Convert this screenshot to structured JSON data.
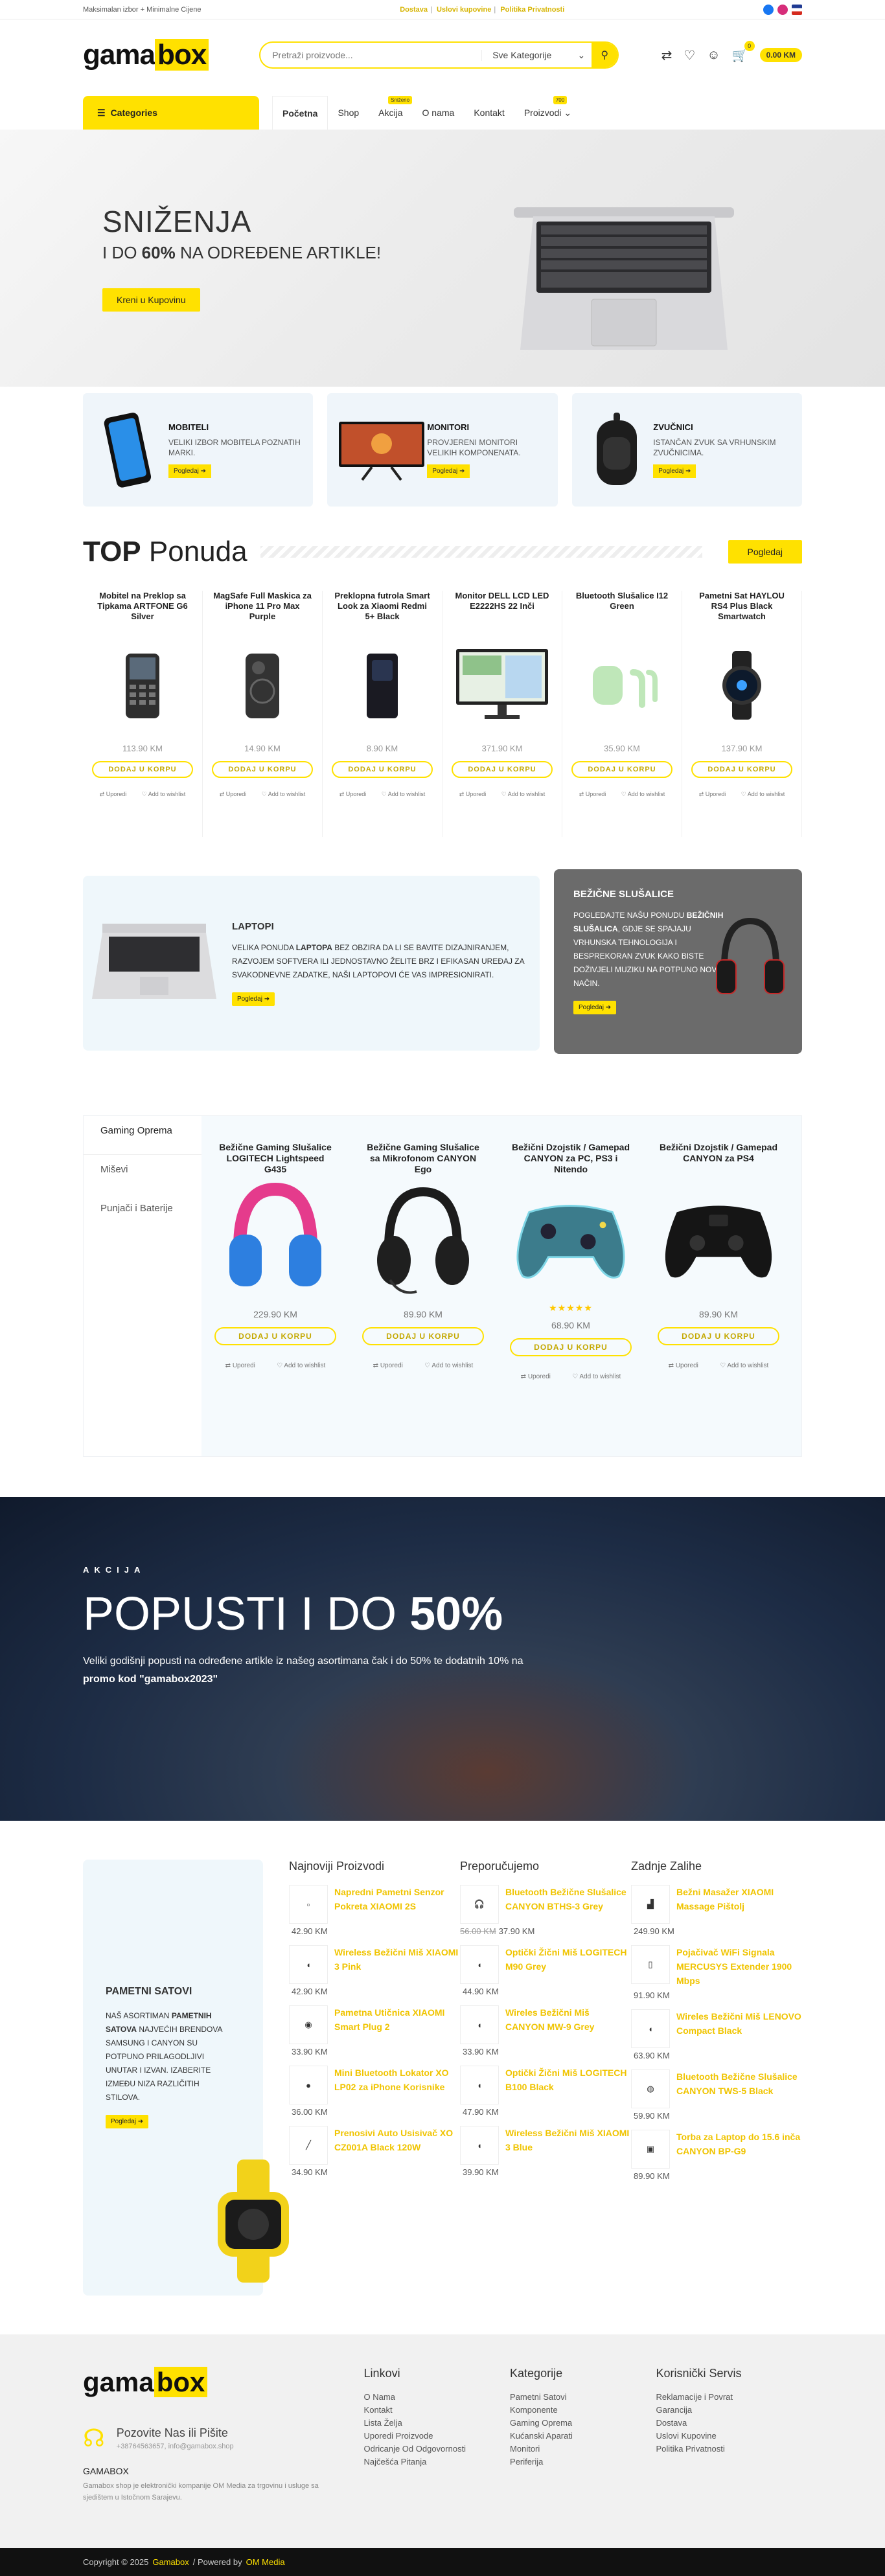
{
  "topbar": {
    "left": "Maksimalan izbor + Minimalne Cijene",
    "links": [
      "Dostava",
      "Uslovi kupovine",
      "Politika Privatnosti"
    ]
  },
  "header": {
    "logo_main": "gama",
    "logo_box": "box",
    "search_placeholder": "Pretraži proizvode...",
    "search_category": "Sve Kategorije",
    "cart_count": "0",
    "cart_total": "0.00 KM"
  },
  "nav": {
    "categories": "Categories",
    "items": [
      {
        "label": "Početna",
        "tag": ""
      },
      {
        "label": "Shop",
        "tag": ""
      },
      {
        "label": "Akcija",
        "tag": "Sniženo"
      },
      {
        "label": "O nama",
        "tag": ""
      },
      {
        "label": "Kontakt",
        "tag": ""
      },
      {
        "label": "Proizvodi",
        "tag": "700"
      }
    ]
  },
  "hero": {
    "title": "SNIŽENJA",
    "sub_pre": "I DO ",
    "sub_bold": "60%",
    "sub_post": " NA ODREĐENE ARTIKLE!",
    "button": "Kreni u Kupovinu"
  },
  "promos": [
    {
      "title": "MOBITELI",
      "text": "VELIKI IZBOR MOBITELA POZNATIH MARKI.",
      "button": "Pogledaj"
    },
    {
      "title": "MONITORI",
      "text": "PROVJERENI MONITORI VELIKIH KOMPONENATA.",
      "button": "Pogledaj"
    },
    {
      "title": "ZVUČNICI",
      "text": "ISTANČAN ZVUK SA VRHUNSKIM ZVUČNICIMA.",
      "button": "Pogledaj"
    }
  ],
  "top": {
    "title_bold": "TOP",
    "title_rest": " Ponuda",
    "button": "Pogledaj",
    "products": [
      {
        "name": "Mobitel na Preklop sa Tipkama ARTFONE G6 Silver",
        "price": "113.90 KM"
      },
      {
        "name": "MagSafe Full Maskica za iPhone 11 Pro Max Purple",
        "price": "14.90 KM"
      },
      {
        "name": "Preklopna futrola Smart Look za Xiaomi Redmi 5+ Black",
        "price": "8.90 KM"
      },
      {
        "name": "Monitor DELL LCD LED E2222HS 22 Inči",
        "price": "371.90 KM"
      },
      {
        "name": "Bluetooth Slušalice I12 Green",
        "price": "35.90 KM"
      },
      {
        "name": "Pametni Sat HAYLOU RS4 Plus Black Smartwatch",
        "price": "137.90 KM"
      }
    ],
    "add_label": "DODAJ U KORPU",
    "compare": "Uporedi",
    "wishlist": "Add to wishlist"
  },
  "laptops": {
    "title": "LAPTOPI",
    "text_pre": "VELIKA PONUDA ",
    "text_bold": "LAPTOPA",
    "text_post": " BEZ OBZIRA DA LI SE BAVITE DIZAJNIRANJEM, RAZVOJEM SOFTVERA ILI JEDNOSTAVNO ŽELITE BRZ I EFIKASAN UREĐAJ ZA SVAKODNEVNE ZADATKE, NAŠI LAPTOPOVI ĆE VAS IMPRESIONIRATI.",
    "button": "Pogledaj"
  },
  "wireless": {
    "title": "BEŽIČNE SLUŠALICE",
    "text_pre": "POGLEDAJTE NAŠU PONUDU ",
    "text_bold": "BEŽIČNIH SLUŠALICA",
    "text_post": ", GDJE SE SPAJAJU VRHUNSKA TEHNOLOGIJA I BESPREKORAN ZVUK KAKO BISTE DOŽIVJELI MUZIKU NA POTPUNO NOV NAČIN.",
    "button": "Pogledaj"
  },
  "gaming": {
    "tabs": [
      "Gaming Oprema",
      "Miševi",
      "Punjači i Baterije"
    ],
    "products": [
      {
        "name": "Bežične Gaming Slušalice LOGITECH Lightspeed G435",
        "price": "229.90 KM",
        "stars": ""
      },
      {
        "name": "Bežične Gaming Slušalice sa Mikrofonom CANYON Ego",
        "price": "89.90 KM",
        "stars": ""
      },
      {
        "name": "Bežični Dzojstik / Gamepad CANYON za PC, PS3 i Nitendo",
        "price": "68.90 KM",
        "stars": "★★★★★"
      },
      {
        "name": "Bežični Dzojstik / Gamepad CANYON za PS4",
        "price": "89.90 KM",
        "stars": ""
      }
    ]
  },
  "akcija": {
    "kicker": "AKCIJA",
    "title_pre": "POPUSTI I DO ",
    "title_bold": "50%",
    "line1": "Veliki godišnji popusti na određene artikle iz našeg asortimana čak i do 50% te dodatnih 10% na",
    "line2": "promo kod \"gamabox2023\""
  },
  "smartwatch": {
    "title": "PAMETNI SATOVI",
    "text_pre": "NAŠ ASORTIMAN ",
    "text_bold": "PAMETNIH SATOVA",
    "text_post": " NAJVEĆIH BRENDOVA SAMSUNG I CANYON SU POTPUNO PRILAGODLJIVI UNUTAR I IZVAN. IZABERITE IZMEĐU NIZA RAZLIČITIH STILOVA.",
    "button": "Pogledaj"
  },
  "lists": [
    {
      "title": "Najnoviji Proizvodi",
      "items": [
        {
          "name": "Napredni Pametni Senzor Pokreta XIAOMI 2S",
          "old": "",
          "price": "42.90 KM",
          "icon": "sensor-icon"
        },
        {
          "name": "Wireless Bežični Miš XIAOMI 3 Pink",
          "old": "",
          "price": "42.90 KM",
          "icon": "mouse-icon"
        },
        {
          "name": "Pametna Utičnica XIAOMI Smart Plug 2",
          "old": "",
          "price": "33.90 KM",
          "icon": "plug-icon"
        },
        {
          "name": "Mini Bluetooth Lokator XO LP02 za iPhone Korisnike",
          "old": "",
          "price": "36.00 KM",
          "icon": "tracker-icon"
        },
        {
          "name": "Prenosivi Auto Usisivač XO CZ001A Black 120W",
          "old": "",
          "price": "34.90 KM",
          "icon": "vacuum-icon"
        }
      ]
    },
    {
      "title": "Preporučujemo",
      "items": [
        {
          "name": "Bluetooth Bežične Slušalice CANYON BTHS-3 Grey",
          "old": "56.00 KM",
          "price": "37.90 KM",
          "icon": "headphones-icon"
        },
        {
          "name": "Optički Žični Miš LOGITECH M90 Grey",
          "old": "",
          "price": "44.90 KM",
          "icon": "mouse-icon"
        },
        {
          "name": "Wireles Bežični Miš CANYON MW-9 Grey",
          "old": "",
          "price": "33.90 KM",
          "icon": "mouse-icon"
        },
        {
          "name": "Optički Žični Miš LOGITECH B100 Black",
          "old": "",
          "price": "47.90 KM",
          "icon": "mouse-icon"
        },
        {
          "name": "Wireless Bežični Miš XIAOMI 3 Blue",
          "old": "",
          "price": "39.90 KM",
          "icon": "mouse-icon"
        }
      ]
    },
    {
      "title": "Zadnje Zalihe",
      "items": [
        {
          "name": "Bežni Masažer XIAOMI Massage Pištolj",
          "old": "",
          "price": "249.90 KM",
          "icon": "massager-icon"
        },
        {
          "name": "Pojačivač WiFi Signala MERCUSYS Extender 1900 Mbps",
          "old": "",
          "price": "91.90 KM",
          "icon": "router-icon"
        },
        {
          "name": "Wireles Bežični Miš LENOVO Compact Black",
          "old": "",
          "price": "63.90 KM",
          "icon": "mouse-icon"
        },
        {
          "name": "Bluetooth Bežične Slušalice CANYON TWS-5 Black",
          "old": "",
          "price": "59.90 KM",
          "icon": "earbuds-icon"
        },
        {
          "name": "Torba za Laptop do 15.6 inča CANYON BP-G9",
          "old": "",
          "price": "89.90 KM",
          "icon": "bag-icon"
        }
      ]
    }
  ],
  "footer": {
    "call_label": "Pozovite Nas ili Pišite",
    "call_sub": "+38764563657, info@gamabox.shop",
    "company": "GAMABOX",
    "desc": "Gamabox shop je elektronički kompanije OM Media za trgovinu i usluge sa sjedištem u Istočnom Sarajevu.",
    "cols": [
      {
        "title": "Linkovi",
        "items": [
          "O Nama",
          "Kontakt",
          "Lista Želja",
          "Uporedi Proizvode",
          "Odricanje Od Odgovornosti",
          "Najčešća Pitanja"
        ]
      },
      {
        "title": "Kategorije",
        "items": [
          "Pametni Satovi",
          "Komponente",
          "Gaming Oprema",
          "Kućanski Aparati",
          "Monitori",
          "Periferija"
        ]
      },
      {
        "title": "Korisnički Servis",
        "items": [
          "Reklamacije i Povrat",
          "Garancija",
          "Dostava",
          "Uslovi Kupovine",
          "Politika Privatnosti"
        ]
      }
    ],
    "copyright": "Copyright © 2025",
    "brand": "Gamabox",
    "powered": "/ Powered by",
    "powered_by": "OM Media"
  },
  "colors": {
    "accent": "#ffe100",
    "link": "#f0c400"
  }
}
